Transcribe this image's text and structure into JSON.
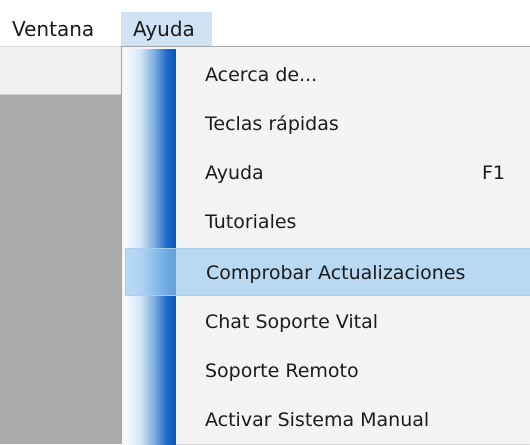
{
  "menubar": {
    "items": [
      {
        "label": "Ventana"
      },
      {
        "label": "Ayuda"
      }
    ]
  },
  "dropdown": {
    "items": [
      {
        "label": "Acerca de...",
        "shortcut": ""
      },
      {
        "label": "Teclas rápidas",
        "shortcut": ""
      },
      {
        "label": "Ayuda",
        "shortcut": "F1"
      },
      {
        "label": "Tutoriales",
        "shortcut": ""
      },
      {
        "label": "Comprobar Actualizaciones",
        "shortcut": "",
        "highlighted": true
      },
      {
        "label": "Chat Soporte Vital",
        "shortcut": ""
      },
      {
        "label": "Soporte Remoto",
        "shortcut": ""
      },
      {
        "label": "Activar Sistema Manual",
        "shortcut": ""
      }
    ]
  }
}
